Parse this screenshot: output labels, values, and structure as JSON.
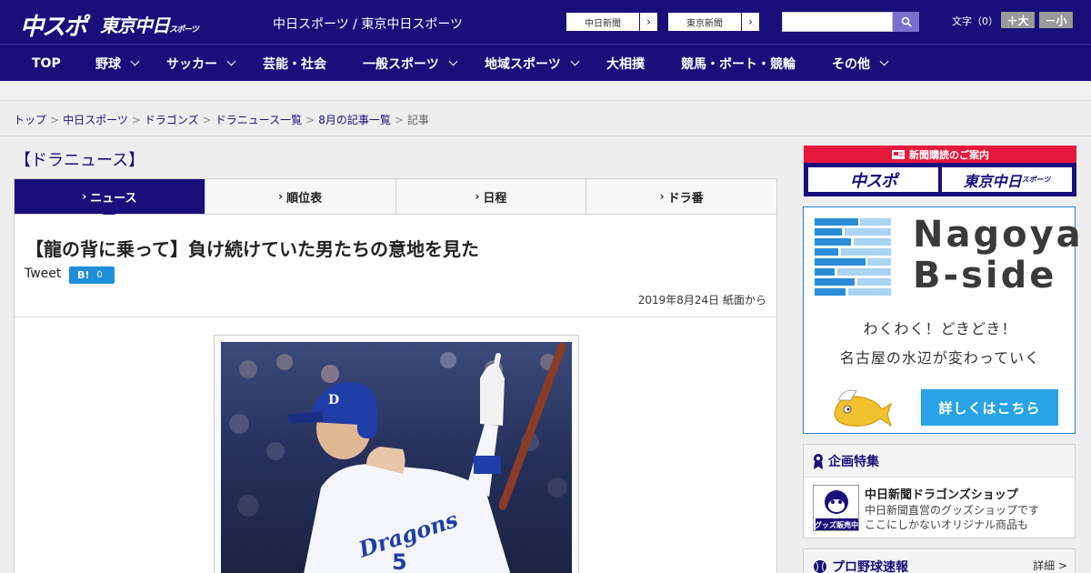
{
  "header": {
    "logo_chuspo": "中スポ",
    "logo_tokyo": "東京中日",
    "logo_tokyo_sub": "スポーツ",
    "site_name": "中日スポーツ / 東京中日スポーツ",
    "paper_links": [
      {
        "label": "中日新聞"
      },
      {
        "label": "東京新聞"
      }
    ],
    "search_placeholder": "",
    "font_size_label": "文字（0）",
    "font_larger": "＋大",
    "font_smaller": "－小"
  },
  "nav": [
    {
      "label": "TOP",
      "dropdown": false
    },
    {
      "label": "野球",
      "dropdown": true
    },
    {
      "label": "サッカー",
      "dropdown": true
    },
    {
      "label": "芸能・社会",
      "dropdown": false
    },
    {
      "label": "一般スポーツ",
      "dropdown": true
    },
    {
      "label": "地域スポーツ",
      "dropdown": true
    },
    {
      "label": "大相撲",
      "dropdown": false
    },
    {
      "label": "競馬・ボート・競輪",
      "dropdown": false
    },
    {
      "label": "その他",
      "dropdown": true
    }
  ],
  "breadcrumb": {
    "items": [
      "トップ",
      "中日スポーツ",
      "ドラゴンズ",
      "ドラニュース一覧",
      "8月の記事一覧"
    ],
    "current": "記事"
  },
  "main": {
    "section_title": "【ドラニュース】",
    "tabs": [
      {
        "label": "ニュース",
        "active": true
      },
      {
        "label": "順位表",
        "active": false
      },
      {
        "label": "日程",
        "active": false
      },
      {
        "label": "ドラ番",
        "active": false
      }
    ],
    "article": {
      "title": "【龍の背に乗って】負け続けていた男たちの意地を見た",
      "tweet_label": "Tweet",
      "hatebu_label": "B!",
      "hatebu_count": "0",
      "date": "2019年8月24日 紙面から"
    }
  },
  "photo": {
    "jersey_text": "Dragons",
    "jersey_number": "5"
  },
  "sidebar": {
    "subscribe": {
      "heading": "新聞購読のご案内",
      "logo_left": "中スポ",
      "logo_right": "東京中日",
      "logo_right_sub": "スポーツ"
    },
    "ad": {
      "title_line1": "Nagoya",
      "title_line2": "B-side",
      "line1": "わくわく！どきどき！",
      "line2": "名古屋の水辺が変わっていく",
      "cta": "詳しくはこちら"
    },
    "feature": {
      "heading": "企画特集",
      "name": "中日新聞ドラゴンズショップ",
      "desc_line1": "中日新聞直営のグッズショップです",
      "desc_line2": "ここにしかないオリジナル商品も",
      "thumb_badge": "グッズ販売中"
    },
    "scores": {
      "heading": "プロ野球速報",
      "more": "詳細 >"
    }
  },
  "colors": {
    "brand_navy": "#1a0f7a",
    "accent_red": "#e8183c",
    "ad_blue": "#29a3e6",
    "hatebu_blue": "#1e8ed8"
  }
}
